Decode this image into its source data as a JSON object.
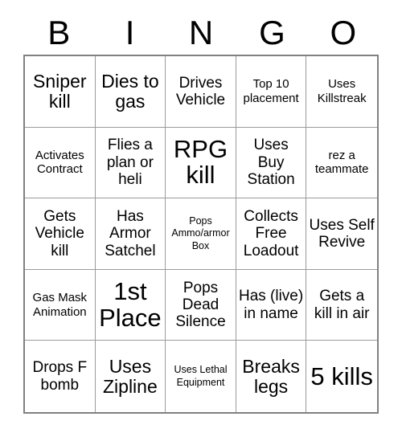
{
  "card": {
    "header_letters": [
      "B",
      "I",
      "N",
      "G",
      "O"
    ],
    "rows": [
      [
        {
          "text": "Sniper kill",
          "size": "lg"
        },
        {
          "text": "Dies to gas",
          "size": "lg"
        },
        {
          "text": "Drives Vehicle",
          "size": "md"
        },
        {
          "text": "Top 10 placement",
          "size": "sm"
        },
        {
          "text": "Uses Killstreak",
          "size": "sm"
        }
      ],
      [
        {
          "text": "Activates Contract",
          "size": "sm"
        },
        {
          "text": "Flies a plan or heli",
          "size": "md"
        },
        {
          "text": "RPG kill",
          "size": "xxl"
        },
        {
          "text": "Uses Buy Station",
          "size": "md"
        },
        {
          "text": "rez a teammate",
          "size": "sm"
        }
      ],
      [
        {
          "text": "Gets Vehicle kill",
          "size": "md"
        },
        {
          "text": "Has Armor Satchel",
          "size": "md"
        },
        {
          "text": "Pops Ammo/armor Box",
          "size": "xs"
        },
        {
          "text": "Collects Free Loadout",
          "size": "md"
        },
        {
          "text": "Uses Self Revive",
          "size": "md"
        }
      ],
      [
        {
          "text": "Gas Mask Animation",
          "size": "sm"
        },
        {
          "text": "1st Place",
          "size": "xxl"
        },
        {
          "text": "Pops Dead Silence",
          "size": "md"
        },
        {
          "text": "Has (live) in name",
          "size": "md"
        },
        {
          "text": "Gets a kill in air",
          "size": "md"
        }
      ],
      [
        {
          "text": "Drops F bomb",
          "size": "md"
        },
        {
          "text": "Uses Zipline",
          "size": "lg"
        },
        {
          "text": "Uses Lethal Equipment",
          "size": "xs"
        },
        {
          "text": "Breaks legs",
          "size": "lg"
        },
        {
          "text": "5 kills",
          "size": "xxl"
        }
      ]
    ]
  },
  "colors": {
    "background": "#ffffff",
    "text": "#000000",
    "outer_border": "#808080",
    "inner_border": "#9a9a9a"
  }
}
